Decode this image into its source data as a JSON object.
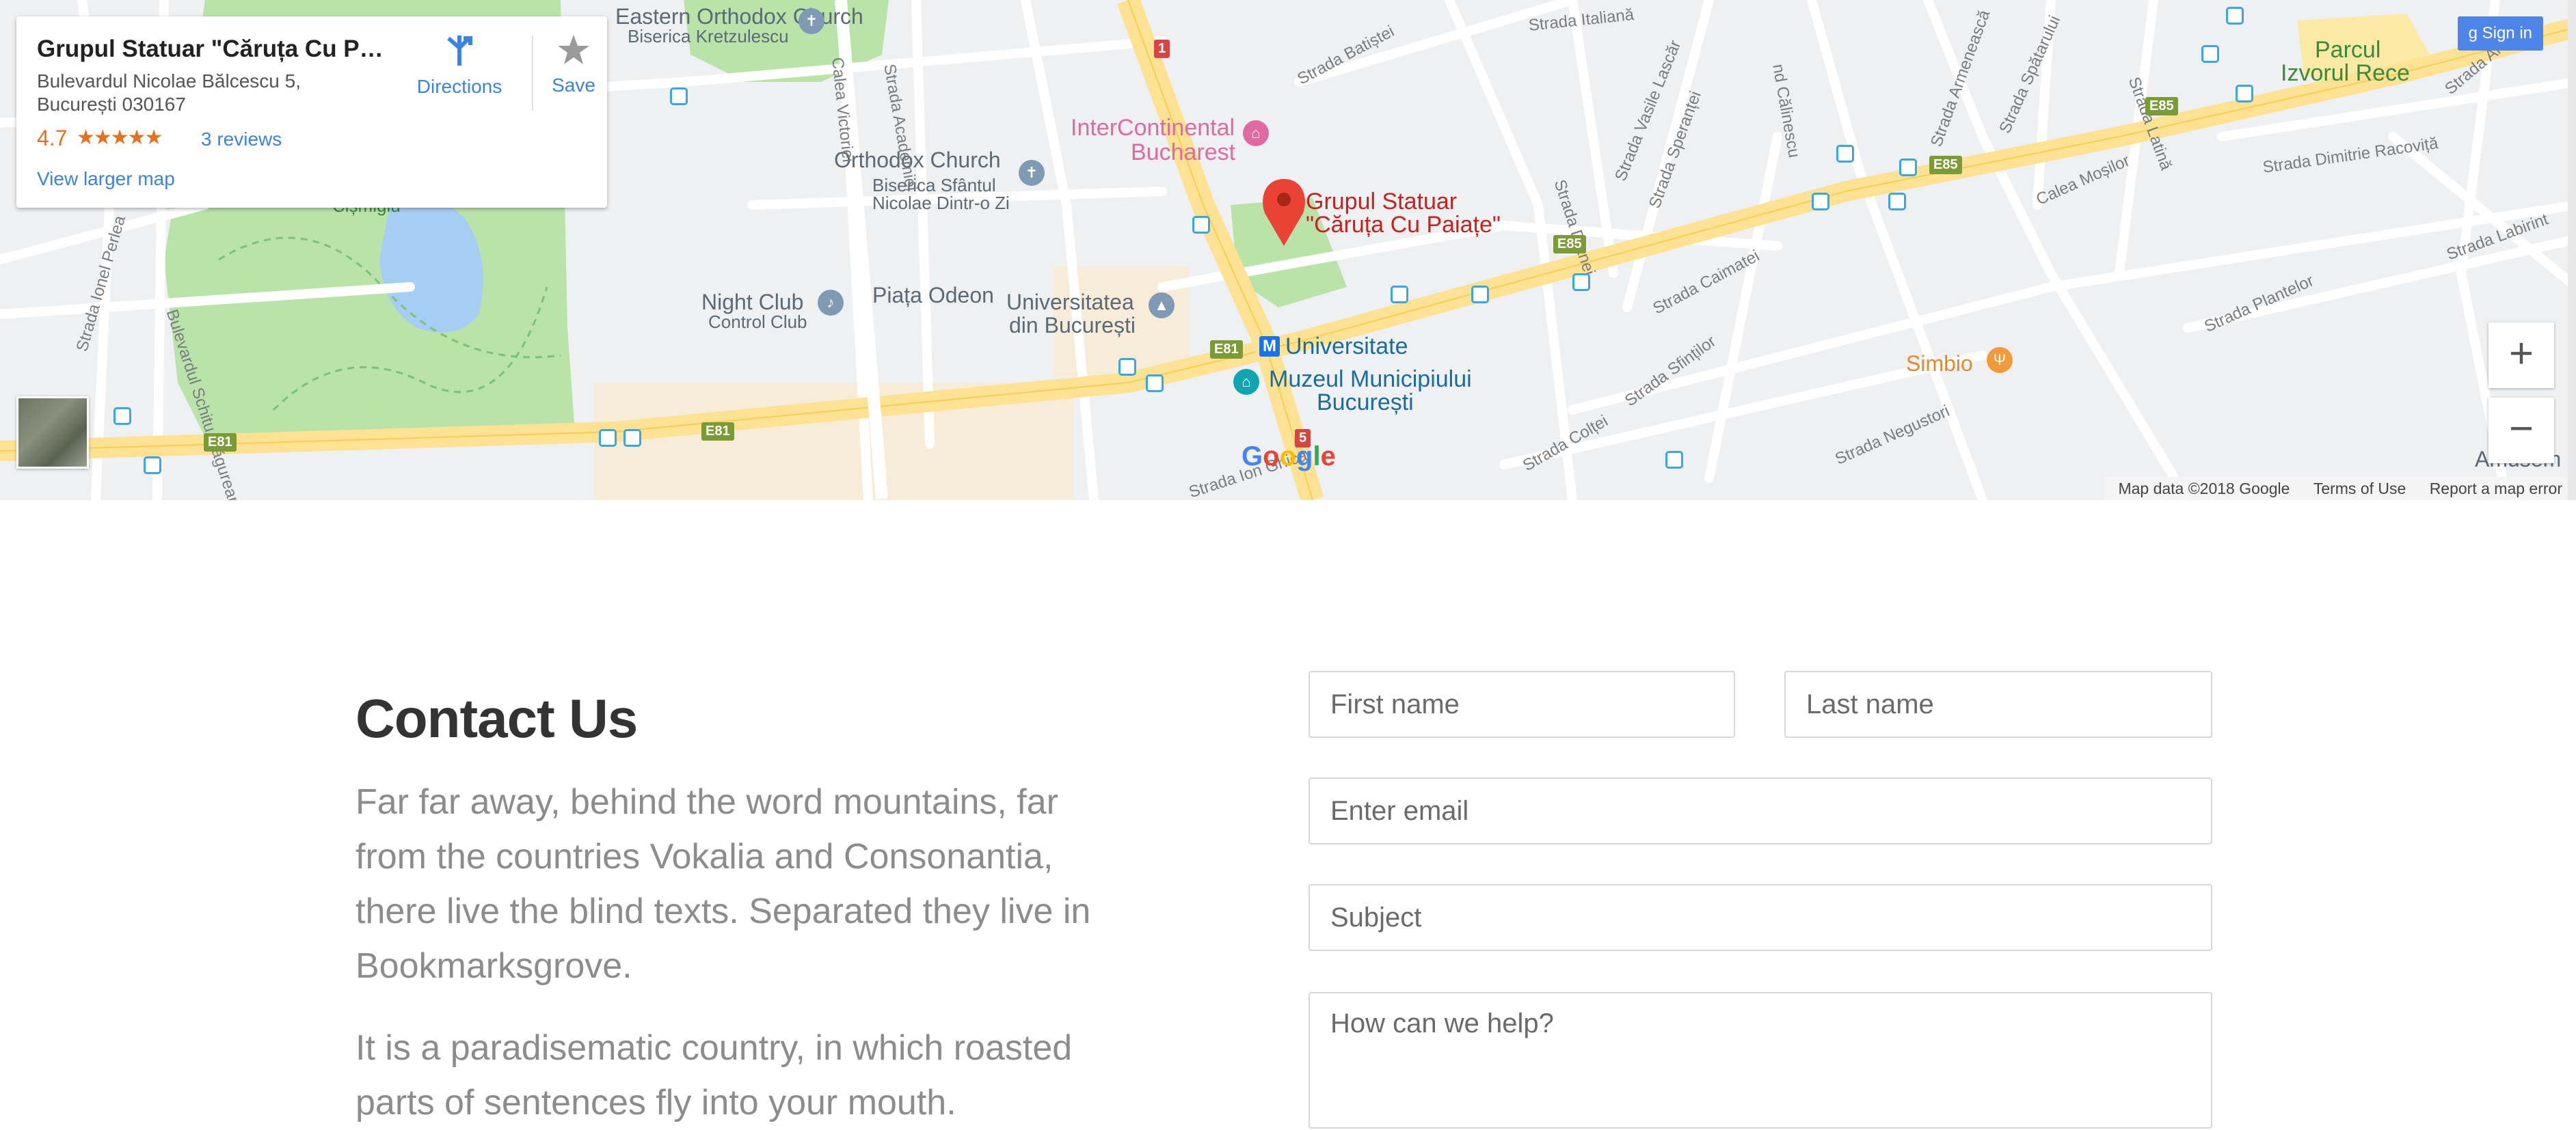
{
  "map": {
    "infocard": {
      "title": "Grupul Statuar \"Căruța Cu Pai...",
      "address_line1": "Bulevardul Nicolae Bălcescu 5,",
      "address_line2": "București 030167",
      "rating": "4.7",
      "stars": "★★★★★",
      "reviews": "3 reviews",
      "view_larger": "View larger map",
      "directions": "Directions",
      "save": "Save"
    },
    "sign_in": "Sign in",
    "marker_label_line1": "Grupul Statuar",
    "marker_label_line2": "\"Căruța Cu Paiațe\"",
    "places": {
      "orthodox_church_top": "Eastern Orthodox Church",
      "biserica_kretzulescu": "Biserica Kretzulescu",
      "orthodox_church": "Orthodox Church",
      "biserica_sf_nicolae_1": "Biserica Sfântul",
      "biserica_sf_nicolae_2": "Nicolae Dintr-o Zi",
      "intercontinental_1": "InterContinental",
      "intercontinental_2": "Bucharest",
      "night_club_1": "Night Club",
      "night_club_2": "Control Club",
      "piata_odeon": "Piața Odeon",
      "universitatea_1": "Universitatea",
      "universitatea_2": "din București",
      "universitate_metro": "Universitate",
      "muzeul_1": "Muzeul Municipiului",
      "muzeul_2": "București",
      "simbio": "Simbio",
      "parcul_1": "Parcul",
      "parcul_2": "Izvorul Rece",
      "amusem": "Amusem",
      "cismigiu": "Cișmigiu"
    },
    "streets": {
      "calea_victoriei": "Calea Victoriei",
      "strada_academiei": "Strada Academiei",
      "strada_batistei": "Strada Batiștei",
      "strada_italiana": "Strada Italiană",
      "strada_dianei": "Strada Dianei",
      "strada_vasile_lascar": "Strada Vasile Lascăr",
      "strada_sperantei": "Strada Speranței",
      "strada_armeneasca": "Strada Armenească",
      "strada_spatarului": "Strada Spătarului",
      "strada_latina": "Strada Latină",
      "strada_dimitrie_racovita": "Strada Dimitrie Racoviță",
      "strada_plantelor": "Strada Plantelor",
      "strada_caimatei": "Strada Caimatei",
      "strada_sfintilor": "Strada Sfinților",
      "strada_coltei": "Strada Colței",
      "strada_negustori": "Strada Negustori",
      "calea_mosilor": "Calea Moșilor",
      "strada_ionel_perlea": "Strada Ionel Perlea",
      "bulevardul_schitu": "Bulevardul Schitu Măgureanu",
      "strada_ion_ghica": "Strada Ion Ghica",
      "strada_arm": "Strada Arm",
      "calinescu": "nd Călinescu",
      "strada_labirint": "Strada Labirint"
    },
    "route_labels": {
      "e81": "E81",
      "e85": "E85",
      "r1": "1",
      "r5": "5"
    },
    "google_logo": "Google",
    "attribution": {
      "map_data": "Map data ©2018 Google",
      "terms": "Terms of Use",
      "report": "Report a map error"
    },
    "zoom_in": "+",
    "zoom_out": "−",
    "colors": {
      "park": "#b9e3a9",
      "major_road": "#fde293",
      "water": "#a6cdf3",
      "marker": "#ea4335",
      "link": "#3a84df"
    }
  },
  "contact": {
    "title": "Contact Us",
    "paragraph1": "Far far away, behind the word mountains, far from the countries Vokalia and Consonantia, there live the blind texts. Separated they live in Bookmarksgrove.",
    "paragraph2": "It is a paradisematic country, in which roasted parts of sentences fly into your mouth.",
    "form": {
      "first_name_placeholder": "First name",
      "last_name_placeholder": "Last name",
      "email_placeholder": "Enter email",
      "subject_placeholder": "Subject",
      "message_placeholder": "How can we help?"
    }
  }
}
